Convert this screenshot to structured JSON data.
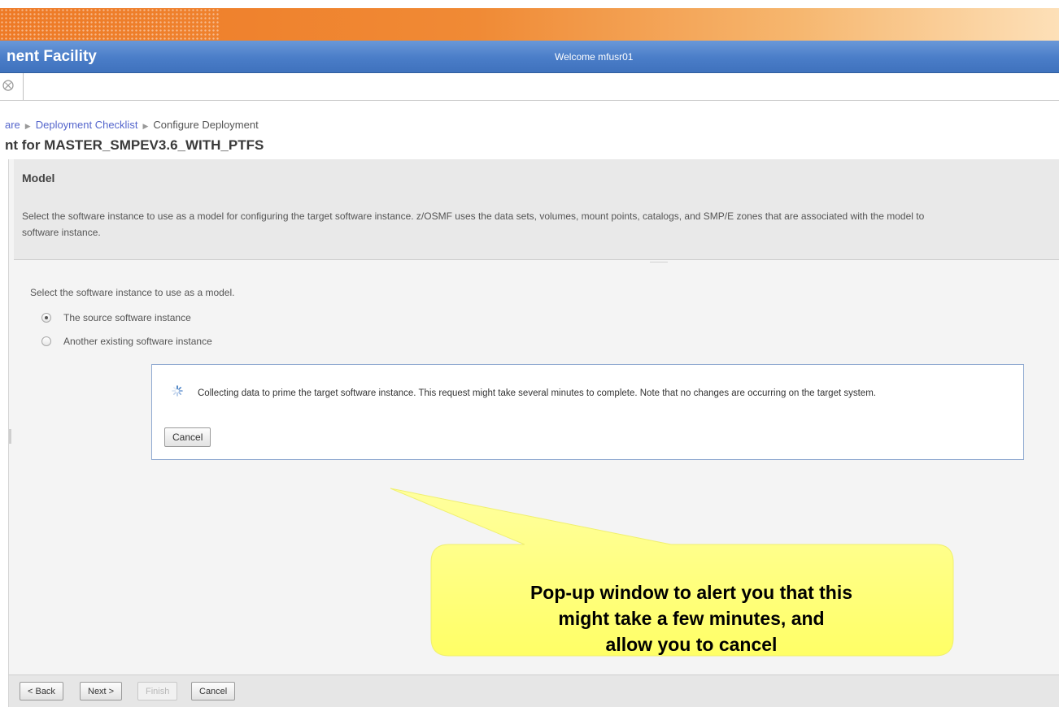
{
  "header": {
    "app_title": "nent Facility",
    "welcome": "Welcome mfusr01"
  },
  "breadcrumb": {
    "items": [
      "are",
      "Deployment Checklist"
    ],
    "current": "Configure Deployment"
  },
  "page": {
    "title": "nt for MASTER_SMPEV3.6_WITH_PTFS"
  },
  "model_section": {
    "heading": "Model",
    "description_line1": "Select the software instance to use as a model for configuring the target software instance.  z/OSMF uses the data sets, volumes, mount points, catalogs, and SMP/E zones that are associated with the model to",
    "description_line2": "software instance."
  },
  "form": {
    "prompt": "Select the software instance to use as a model.",
    "options": [
      {
        "label": "The source software instance",
        "selected": true
      },
      {
        "label": "Another existing software instance",
        "selected": false
      }
    ]
  },
  "dialog": {
    "icon": "spinner-icon",
    "message": "Collecting data to prime the target software instance. This request might take several minutes to complete. Note that no changes are occurring on the target system.",
    "cancel_label": "Cancel"
  },
  "callout": {
    "lines": [
      "Pop-up window to alert you that this",
      "might take a few minutes, and",
      "allow you to cancel"
    ],
    "color": "#ffff99"
  },
  "footer": {
    "back_label": "< Back",
    "next_label": "Next >",
    "finish_label": "Finish",
    "cancel_label": "Cancel"
  },
  "colors": {
    "header_orange": "#ee7a26",
    "title_blue": "#4a7dc8",
    "link_blue": "#5566cc"
  }
}
